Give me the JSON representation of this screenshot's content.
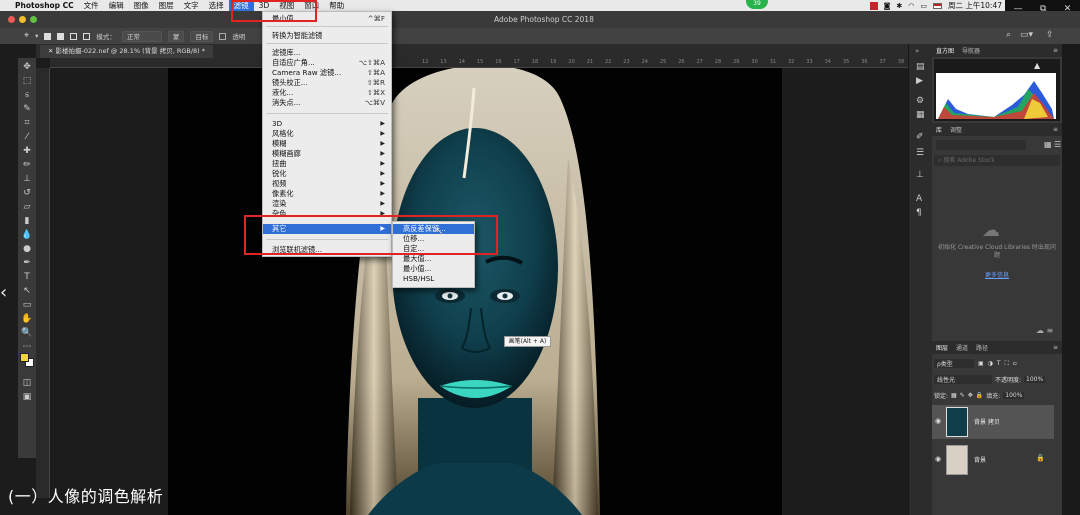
{
  "menubar": {
    "apple": "",
    "app": "Photoshop CC",
    "items": [
      "文件",
      "编辑",
      "图像",
      "图层",
      "文字",
      "选择",
      "滤镜",
      "3D",
      "视图",
      "窗口",
      "帮助"
    ],
    "active_item": "滤镜",
    "clock": "周二 上午10:47",
    "notification_count": "39"
  },
  "titlebar": {
    "title": "Adobe Photoshop CC 2018"
  },
  "options": {
    "mode_label": "模式：",
    "mode_value": "正常",
    "btn1": "蒙",
    "btn2": "目标",
    "checkbox": "透明"
  },
  "document": {
    "tab": "影楼拍摄-022.nef @ 28.1% (背景 拷贝, RGB/8) *"
  },
  "ruler": [
    "12",
    "13",
    "14",
    "15",
    "16",
    "17",
    "18",
    "19",
    "20",
    "21",
    "22",
    "23",
    "24",
    "25",
    "26",
    "27",
    "28",
    "29",
    "30",
    "31",
    "32",
    "33",
    "34",
    "35",
    "36",
    "37",
    "38",
    "39"
  ],
  "filter_menu": {
    "items": [
      {
        "label": "最小值",
        "shortcut": "^⌘F"
      },
      {
        "label": "转换为智能滤镜"
      },
      {
        "label": "滤镜库..."
      },
      {
        "label": "自适应广角...",
        "shortcut": "⌥⇧⌘A"
      },
      {
        "label": "Camera Raw 滤镜...",
        "shortcut": "⇧⌘A"
      },
      {
        "label": "镜头校正...",
        "shortcut": "⇧⌘R"
      },
      {
        "label": "液化...",
        "shortcut": "⇧⌘X"
      },
      {
        "label": "消失点...",
        "shortcut": "⌥⌘V"
      },
      {
        "label": "3D"
      },
      {
        "label": "风格化"
      },
      {
        "label": "模糊"
      },
      {
        "label": "模糊画廊"
      },
      {
        "label": "扭曲"
      },
      {
        "label": "锐化"
      },
      {
        "label": "视频"
      },
      {
        "label": "像素化"
      },
      {
        "label": "渲染"
      },
      {
        "label": "杂色"
      },
      {
        "label": "其它"
      },
      {
        "label": "浏览联机滤镜..."
      }
    ]
  },
  "other_submenu": {
    "items": [
      "高反差保留...",
      "位移...",
      "自定...",
      "最大值...",
      "最小值...",
      "HSB/HSL"
    ]
  },
  "tooltip": "画笔(Alt + A)",
  "panels": {
    "histogram_tabs": [
      "直方图",
      "导航器"
    ],
    "library_tabs": [
      "库",
      "调整"
    ],
    "library_search": "搜索 Adobe Stock",
    "cc_message": "初始化 Creative Cloud Libraries 时出现问题",
    "more_info": "更多信息",
    "layers_tabs": [
      "图层",
      "通道",
      "路径"
    ],
    "kind": "ρ类型",
    "blend_mode": "线性光",
    "opacity_label": "不透明度:",
    "opacity_value": "100%",
    "lock_label": "锁定:",
    "fill_label": "填充:",
    "fill_value": "100%",
    "layers": [
      {
        "name": "背景 拷贝"
      },
      {
        "name": "背景"
      }
    ]
  },
  "caption": "(一）人像的调色解析",
  "colors": {
    "highlight": "#2f6fd6",
    "annotation": "#e02424",
    "foreground": "#f2d43a",
    "background": "#ffffff"
  }
}
